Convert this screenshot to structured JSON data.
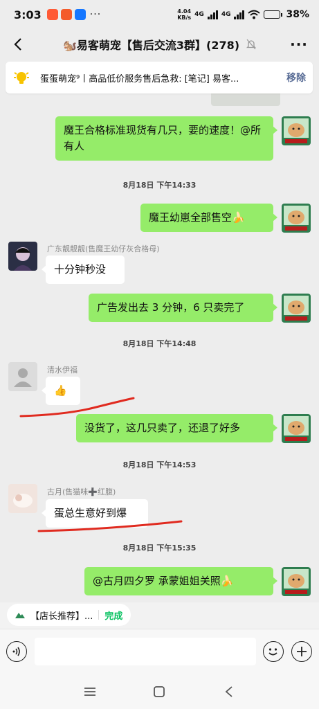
{
  "status_bar": {
    "time": "3:03",
    "network_speed": "4.04",
    "network_unit": "KB/s",
    "net_type_1": "4G",
    "net_type_2": "4G",
    "battery_percent": "38%",
    "battery_level": 0.38
  },
  "header": {
    "title": "🐿️易客萌宠【售后交流3群】(278)"
  },
  "pinned": {
    "text": "蛋蛋萌宠⁹丨高品低价服务售后急救: [笔记] 易客...",
    "remove_label": "移除"
  },
  "messages": [
    {
      "side": "right",
      "text": "魔王合格标准现货有几只，要的速度！@所有人"
    },
    {
      "type": "timestamp",
      "text": "8月18日 下午14:33"
    },
    {
      "side": "right",
      "text": "魔王幼崽全部售空🍌"
    },
    {
      "side": "left",
      "sender": "广东靓靓靓(售魔王幼仔灰合格母)",
      "text": "十分钟秒没"
    },
    {
      "side": "right",
      "text": "广告发出去 3 分钟，6 只卖完了"
    },
    {
      "type": "timestamp",
      "text": "8月18日 下午14:48"
    },
    {
      "side": "left",
      "sender": "清水伊福",
      "text": "👍"
    },
    {
      "side": "right",
      "text": "没货了，这几只卖了，还退了好多"
    },
    {
      "type": "timestamp",
      "text": "8月18日 下午14:53"
    },
    {
      "side": "left",
      "sender": "古月(售猫咪➕红腹)",
      "text": "蛋总生意好到爆"
    },
    {
      "type": "timestamp",
      "text": "8月18日 下午15:35"
    },
    {
      "side": "right",
      "text": "@古月四夕罗  承蒙姐姐关照🍌"
    }
  ],
  "bottom_bar": {
    "recommend_label": "【店长推荐】...",
    "done_label": "完成"
  },
  "colors": {
    "bubble_green": "#95ec69",
    "accent_link": "#576b95",
    "done_green": "#07c160",
    "annotation_red": "#e02a1f"
  },
  "icons": [
    "back-arrow-icon",
    "mute-bell-icon",
    "more-icon",
    "lightbulb-icon",
    "voice-icon",
    "emoji-icon",
    "plus-icon",
    "menu-nav-icon",
    "home-nav-icon",
    "back-nav-icon"
  ]
}
